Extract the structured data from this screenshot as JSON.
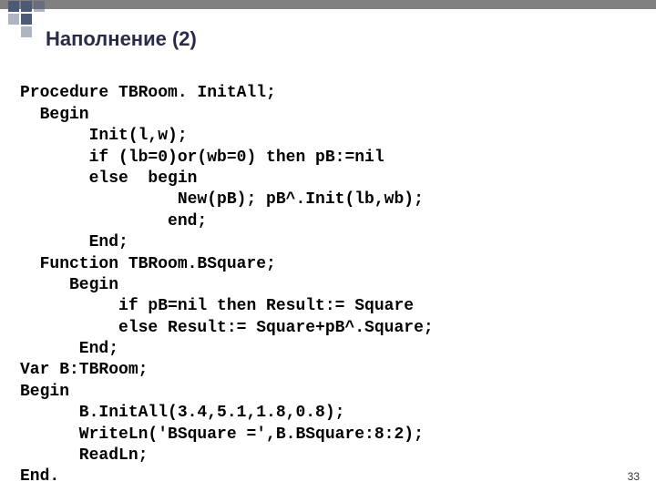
{
  "title": "Наполнение (2)",
  "page_number": "33",
  "code_lines": {
    "l01": "Procedure TBRoom. InitAll;",
    "l02": "  Begin",
    "l03": "       Init(l,w);",
    "l04": "       if (lb=0)or(wb=0) then pB:=nil",
    "l05": "       else  begin",
    "l06": "                New(pB); pB^.Init(lb,wb);",
    "l07": "               end;",
    "l08": "       End;",
    "l09": "  Function TBRoom.BSquare;",
    "l10": "     Begin",
    "l11": "          if pB=nil then Result:= Square",
    "l12": "          else Result:= Square+pB^.Square;",
    "l13": "      End;",
    "l14": "Var B:TBRoom;",
    "l15": "Begin",
    "l16": "      B.InitAll(3.4,5.1,1.8,0.8);",
    "l17": "      WriteLn('BSquare =',B.BSquare:8:2);",
    "l18": "      ReadLn;",
    "l19": "End."
  }
}
